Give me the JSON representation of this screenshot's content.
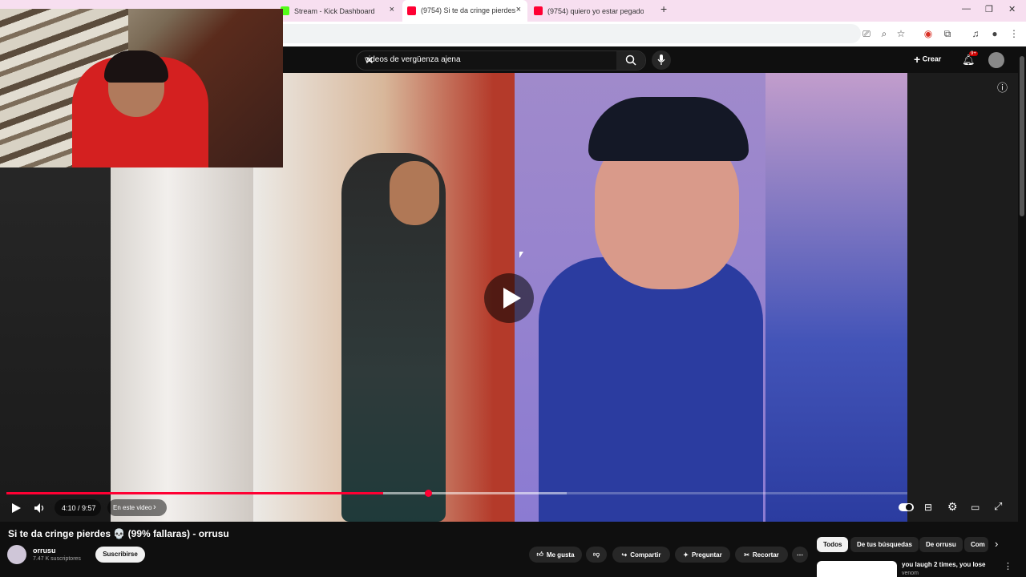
{
  "browser": {
    "tabs": [
      {
        "label": "Stream - Kick Dashboard",
        "favicon_color": "#53fc18"
      },
      {
        "label": "(9754) Si te da cringe pierdes 💀",
        "favicon_color": "#ff0033"
      },
      {
        "label": "(9754) quiero yo estar pegado",
        "favicon_color": "#ff0033"
      }
    ],
    "new_tab": "+",
    "close": "×",
    "window_controls": [
      "—",
      "❐",
      "✕"
    ]
  },
  "youtube": {
    "search_value": "videos de vergüenza ajena",
    "create_label": "Crear",
    "notif_badge": "9+"
  },
  "player": {
    "time": "4:10 / 9:57",
    "chapter_label": "En este video",
    "progress": 0.418,
    "buffered": 0.622,
    "info_icon": "ⓘ"
  },
  "video_info": {
    "title": "Si te da cringe pierdes 💀 (99% fallaras) - orrusu",
    "channel": "orrusu",
    "subscribers": "7.47 K suscriptores",
    "subscribe_label": "Suscribirse",
    "actions": [
      "Me gusta",
      "Compartir",
      "Preguntar",
      "Recortar"
    ]
  },
  "chips": [
    "Todos",
    "De tus búsquedas",
    "De orrusu",
    "Com"
  ],
  "recommendation": {
    "title": "you laugh 2 times, you lose",
    "channel": "venom"
  },
  "colors": {
    "accent": "#ff0033",
    "tabbar": "#f7dff0",
    "background": "#0f0f0f"
  }
}
